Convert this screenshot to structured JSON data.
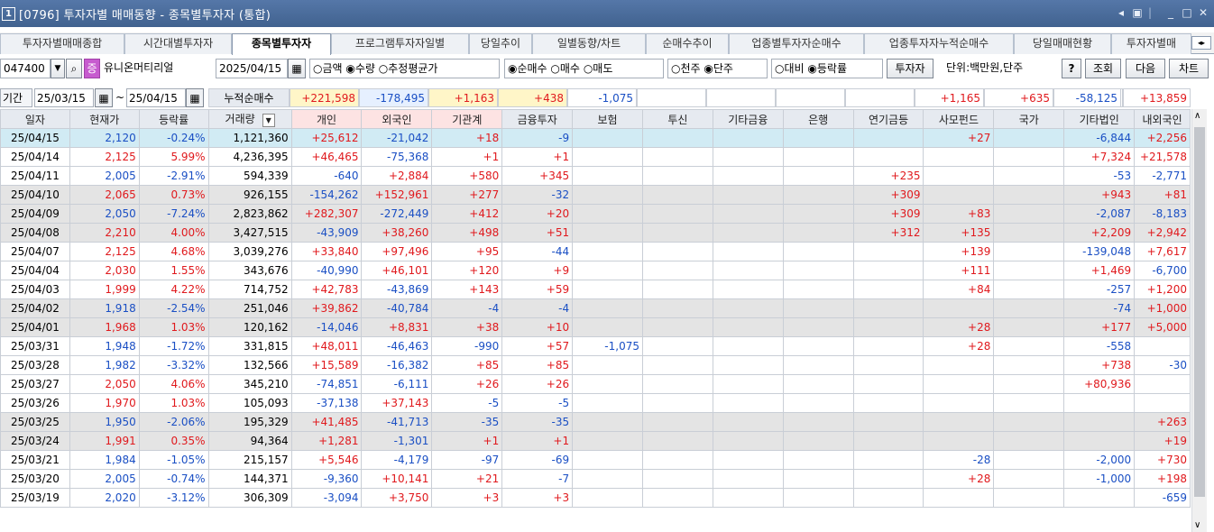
{
  "window": {
    "number": "1",
    "title": "[0796] 투자자별 매매동향 - 종목별투자자 (통합)",
    "controls": [
      "◂",
      "▣",
      "_",
      "□",
      "✕"
    ]
  },
  "tabs": [
    "투자자별매매종합",
    "시간대별투자자",
    "종목별투자자",
    "프로그램투자자일별",
    "당일추이",
    "일별동향/차트",
    "순매수추이",
    "업종별투자자순매수",
    "업종투자자누적순매수",
    "당일매매현황",
    "투자자별매"
  ],
  "active_tab": 2,
  "toolbar": {
    "code": "047400",
    "stock_badge": "증",
    "stock_name": "유니온머티리얼",
    "date": "2025/04/15",
    "radio1": [
      "○금액",
      "◉수량",
      "○추정평균가"
    ],
    "radio2": [
      "◉순매수",
      "○매수",
      "○매도"
    ],
    "radio3": [
      "○천주",
      "◉단주"
    ],
    "radio4": [
      "○대비",
      "◉등락률"
    ],
    "investor_btn": "투자자",
    "unit_label": "단위:백만원,단주",
    "help_btn": "?",
    "query_btn": "조회",
    "next_btn": "다음",
    "chart_btn": "차트"
  },
  "period": {
    "label": "기간",
    "from": "25/03/15",
    "tilde": "~",
    "to": "25/04/15",
    "cum_label": "누적순매수",
    "totals": [
      "+221,598",
      "-178,495",
      "+1,163",
      "+438",
      "-1,075",
      "",
      "",
      "",
      "",
      "+1,165",
      "+635",
      "",
      "-58,125",
      "+13,859"
    ]
  },
  "headers": [
    "일자",
    "현재가",
    "등락률",
    "거래량",
    "개인",
    "외국인",
    "기관계",
    "금융투자",
    "보험",
    "투신",
    "기타금융",
    "은행",
    "연기금등",
    "사모펀드",
    "국가",
    "기타법인",
    "내외국인"
  ],
  "sort_arrow": "▼",
  "rows": [
    [
      "25/04/15",
      "2,120",
      "-0.24%",
      "1,121,360",
      "+25,612",
      "-21,042",
      "+18",
      "-9",
      "",
      "",
      "",
      "",
      "",
      "+27",
      "",
      "-6,844",
      "+2,256"
    ],
    [
      "25/04/14",
      "2,125",
      "5.99%",
      "4,236,395",
      "+46,465",
      "-75,368",
      "+1",
      "+1",
      "",
      "",
      "",
      "",
      "",
      "",
      "",
      "+7,324",
      "+21,578"
    ],
    [
      "25/04/11",
      "2,005",
      "-2.91%",
      "594,339",
      "-640",
      "+2,884",
      "+580",
      "+345",
      "",
      "",
      "",
      "",
      "+235",
      "",
      "",
      "-53",
      "-2,771"
    ],
    [
      "25/04/10",
      "2,065",
      "0.73%",
      "926,155",
      "-154,262",
      "+152,961",
      "+277",
      "-32",
      "",
      "",
      "",
      "",
      "+309",
      "",
      "",
      "+943",
      "+81"
    ],
    [
      "25/04/09",
      "2,050",
      "-7.24%",
      "2,823,862",
      "+282,307",
      "-272,449",
      "+412",
      "+20",
      "",
      "",
      "",
      "",
      "+309",
      "+83",
      "",
      "-2,087",
      "-8,183"
    ],
    [
      "25/04/08",
      "2,210",
      "4.00%",
      "3,427,515",
      "-43,909",
      "+38,260",
      "+498",
      "+51",
      "",
      "",
      "",
      "",
      "+312",
      "+135",
      "",
      "+2,209",
      "+2,942"
    ],
    [
      "25/04/07",
      "2,125",
      "4.68%",
      "3,039,276",
      "+33,840",
      "+97,496",
      "+95",
      "-44",
      "",
      "",
      "",
      "",
      "",
      "+139",
      "",
      "-139,048",
      "+7,617"
    ],
    [
      "25/04/04",
      "2,030",
      "1.55%",
      "343,676",
      "-40,990",
      "+46,101",
      "+120",
      "+9",
      "",
      "",
      "",
      "",
      "",
      "+111",
      "",
      "+1,469",
      "-6,700"
    ],
    [
      "25/04/03",
      "1,999",
      "4.22%",
      "714,752",
      "+42,783",
      "-43,869",
      "+143",
      "+59",
      "",
      "",
      "",
      "",
      "",
      "+84",
      "",
      "-257",
      "+1,200"
    ],
    [
      "25/04/02",
      "1,918",
      "-2.54%",
      "251,046",
      "+39,862",
      "-40,784",
      "-4",
      "-4",
      "",
      "",
      "",
      "",
      "",
      "",
      "",
      "-74",
      "+1,000"
    ],
    [
      "25/04/01",
      "1,968",
      "1.03%",
      "120,162",
      "-14,046",
      "+8,831",
      "+38",
      "+10",
      "",
      "",
      "",
      "",
      "",
      "+28",
      "",
      "+177",
      "+5,000"
    ],
    [
      "25/03/31",
      "1,948",
      "-1.72%",
      "331,815",
      "+48,011",
      "-46,463",
      "-990",
      "+57",
      "-1,075",
      "",
      "",
      "",
      "",
      "+28",
      "",
      "-558",
      ""
    ],
    [
      "25/03/28",
      "1,982",
      "-3.32%",
      "132,566",
      "+15,589",
      "-16,382",
      "+85",
      "+85",
      "",
      "",
      "",
      "",
      "",
      "",
      "",
      "+738",
      "-30"
    ],
    [
      "25/03/27",
      "2,050",
      "4.06%",
      "345,210",
      "-74,851",
      "-6,111",
      "+26",
      "+26",
      "",
      "",
      "",
      "",
      "",
      "",
      "",
      "+80,936",
      ""
    ],
    [
      "25/03/26",
      "1,970",
      "1.03%",
      "105,093",
      "-37,138",
      "+37,143",
      "-5",
      "-5",
      "",
      "",
      "",
      "",
      "",
      "",
      "",
      "",
      ""
    ],
    [
      "25/03/25",
      "1,950",
      "-2.06%",
      "195,329",
      "+41,485",
      "-41,713",
      "-35",
      "-35",
      "",
      "",
      "",
      "",
      "",
      "",
      "",
      "",
      "+263"
    ],
    [
      "25/03/24",
      "1,991",
      "0.35%",
      "94,364",
      "+1,281",
      "-1,301",
      "+1",
      "+1",
      "",
      "",
      "",
      "",
      "",
      "",
      "",
      "",
      "+19"
    ],
    [
      "25/03/21",
      "1,984",
      "-1.05%",
      "215,157",
      "+5,546",
      "-4,179",
      "-97",
      "-69",
      "",
      "",
      "",
      "",
      "",
      "-28",
      "",
      "-2,000",
      "+730"
    ],
    [
      "25/03/20",
      "2,005",
      "-0.74%",
      "144,371",
      "-9,360",
      "+10,141",
      "+21",
      "-7",
      "",
      "",
      "",
      "",
      "",
      "+28",
      "",
      "-1,000",
      "+198"
    ],
    [
      "25/03/19",
      "2,020",
      "-3.12%",
      "306,309",
      "-3,094",
      "+3,750",
      "+3",
      "+3",
      "",
      "",
      "",
      "",
      "",
      "",
      "",
      "",
      "-659"
    ]
  ],
  "row_styles": [
    "sel",
    "",
    "",
    "gray",
    "gray",
    "gray",
    "",
    "",
    "",
    "gray",
    "gray",
    "",
    "",
    "",
    "",
    "gray",
    "gray",
    "",
    "",
    ""
  ],
  "colors": {
    "up": "#e0191d",
    "down": "#1a4fc4",
    "title_bg": "#4a6b9a",
    "selected_row": "#d1ebf4",
    "gray_row": "#e4e4e4",
    "header_bg": "#e6eaf0"
  }
}
